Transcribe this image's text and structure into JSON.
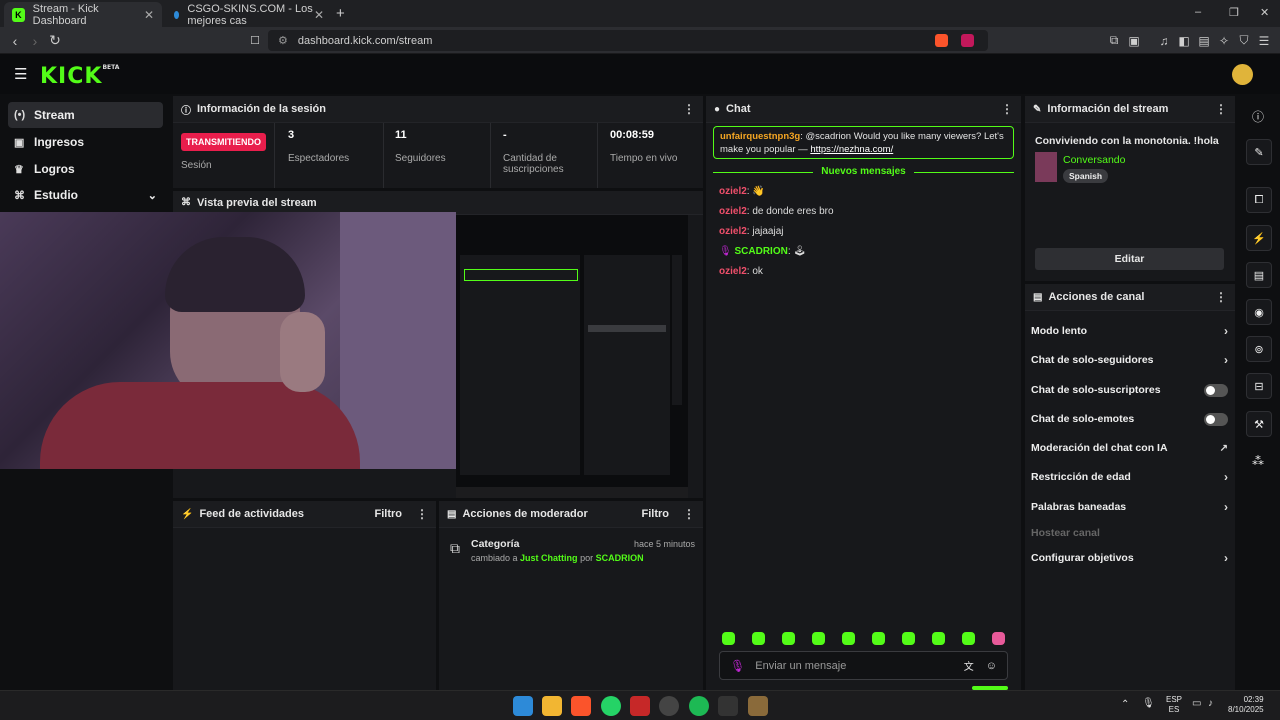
{
  "browser": {
    "tabs": [
      {
        "title": "Stream - Kick Dashboard",
        "fav": "K"
      },
      {
        "title": "CSGO-SKINS.COM - Los mejores cas"
      }
    ],
    "url": "dashboard.kick.com/stream",
    "new_tab": "+",
    "window_controls": [
      "–",
      "❐",
      "✕"
    ]
  },
  "header": {
    "logo": "KICK",
    "logo_tag": "BETA"
  },
  "nav": {
    "items": [
      {
        "label": "Stream",
        "icon": "broadcast-icon"
      },
      {
        "label": "Ingresos",
        "icon": "wallet-icon"
      },
      {
        "label": "Logros",
        "icon": "trophy-icon"
      },
      {
        "label": "Estudio",
        "icon": "studio-icon"
      }
    ]
  },
  "session": {
    "title": "Información de la sesión",
    "live_badge": "TRANSMITIENDO",
    "session_label": "Sesión",
    "stats": [
      {
        "value": "3",
        "label": "Espectadores"
      },
      {
        "value": "11",
        "label": "Seguidores"
      },
      {
        "value": "-",
        "label": "Cantidad de suscripciones"
      },
      {
        "value": "00:08:59",
        "label": "Tiempo en vivo"
      }
    ]
  },
  "preview": {
    "title": "Vista previa del stream"
  },
  "activity": {
    "title": "Feed de actividades",
    "filter": "Filtro"
  },
  "mod_actions": {
    "title": "Acciones de moderador",
    "filter": "Filtro",
    "entry": {
      "heading": "Categoría",
      "time": "hace 5 minutos",
      "prefix": "cambiado a",
      "category": "Just Chatting",
      "by": "por",
      "user": "SCADRION"
    }
  },
  "chat": {
    "title": "Chat",
    "pinned": {
      "user": "unfairquestnpn3g",
      "text": "@scadrion Would you like many viewers? Let's make you popular —",
      "link": "https://nezhna.com/"
    },
    "new_messages": "Nuevos mensajes",
    "messages": [
      {
        "user": "oziel2",
        "text": "👋"
      },
      {
        "user": "oziel2",
        "text": "de donde eres bro"
      },
      {
        "user": "oziel2",
        "text": "jajaajaj"
      },
      {
        "user": "SCADRION",
        "text": "🕹"
      },
      {
        "user": "oziel2",
        "text": "ok"
      }
    ],
    "input_placeholder": "Enviar un mensaje"
  },
  "stream_info": {
    "title": "Información del stream",
    "stream_title": "Conviviendo con la monotonia. !hola",
    "category": "Conversando",
    "language": "Spanish",
    "edit": "Editar"
  },
  "channel_actions": {
    "title": "Acciones de canal",
    "items": [
      {
        "label": "Modo lento",
        "control": "chevron"
      },
      {
        "label": "Chat de solo-seguidores",
        "control": "chevron"
      },
      {
        "label": "Chat de solo-suscriptores",
        "control": "toggle"
      },
      {
        "label": "Chat de solo-emotes",
        "control": "toggle"
      },
      {
        "label": "Moderación del chat con IA",
        "control": "external"
      },
      {
        "label": "Restricción de edad",
        "control": "chevron"
      },
      {
        "label": "Palabras baneadas",
        "control": "chevron"
      },
      {
        "label": "Hostear canal",
        "control": "none"
      },
      {
        "label": "Configurar objetivos",
        "control": "chevron"
      }
    ]
  },
  "taskbar": {
    "lang": "ESP",
    "lang2": "ES",
    "time": "02:39",
    "date": "8/10/2025"
  },
  "colors": {
    "accent": "#53fc18",
    "live": "#e91e4c",
    "username": "#f04f6b"
  }
}
